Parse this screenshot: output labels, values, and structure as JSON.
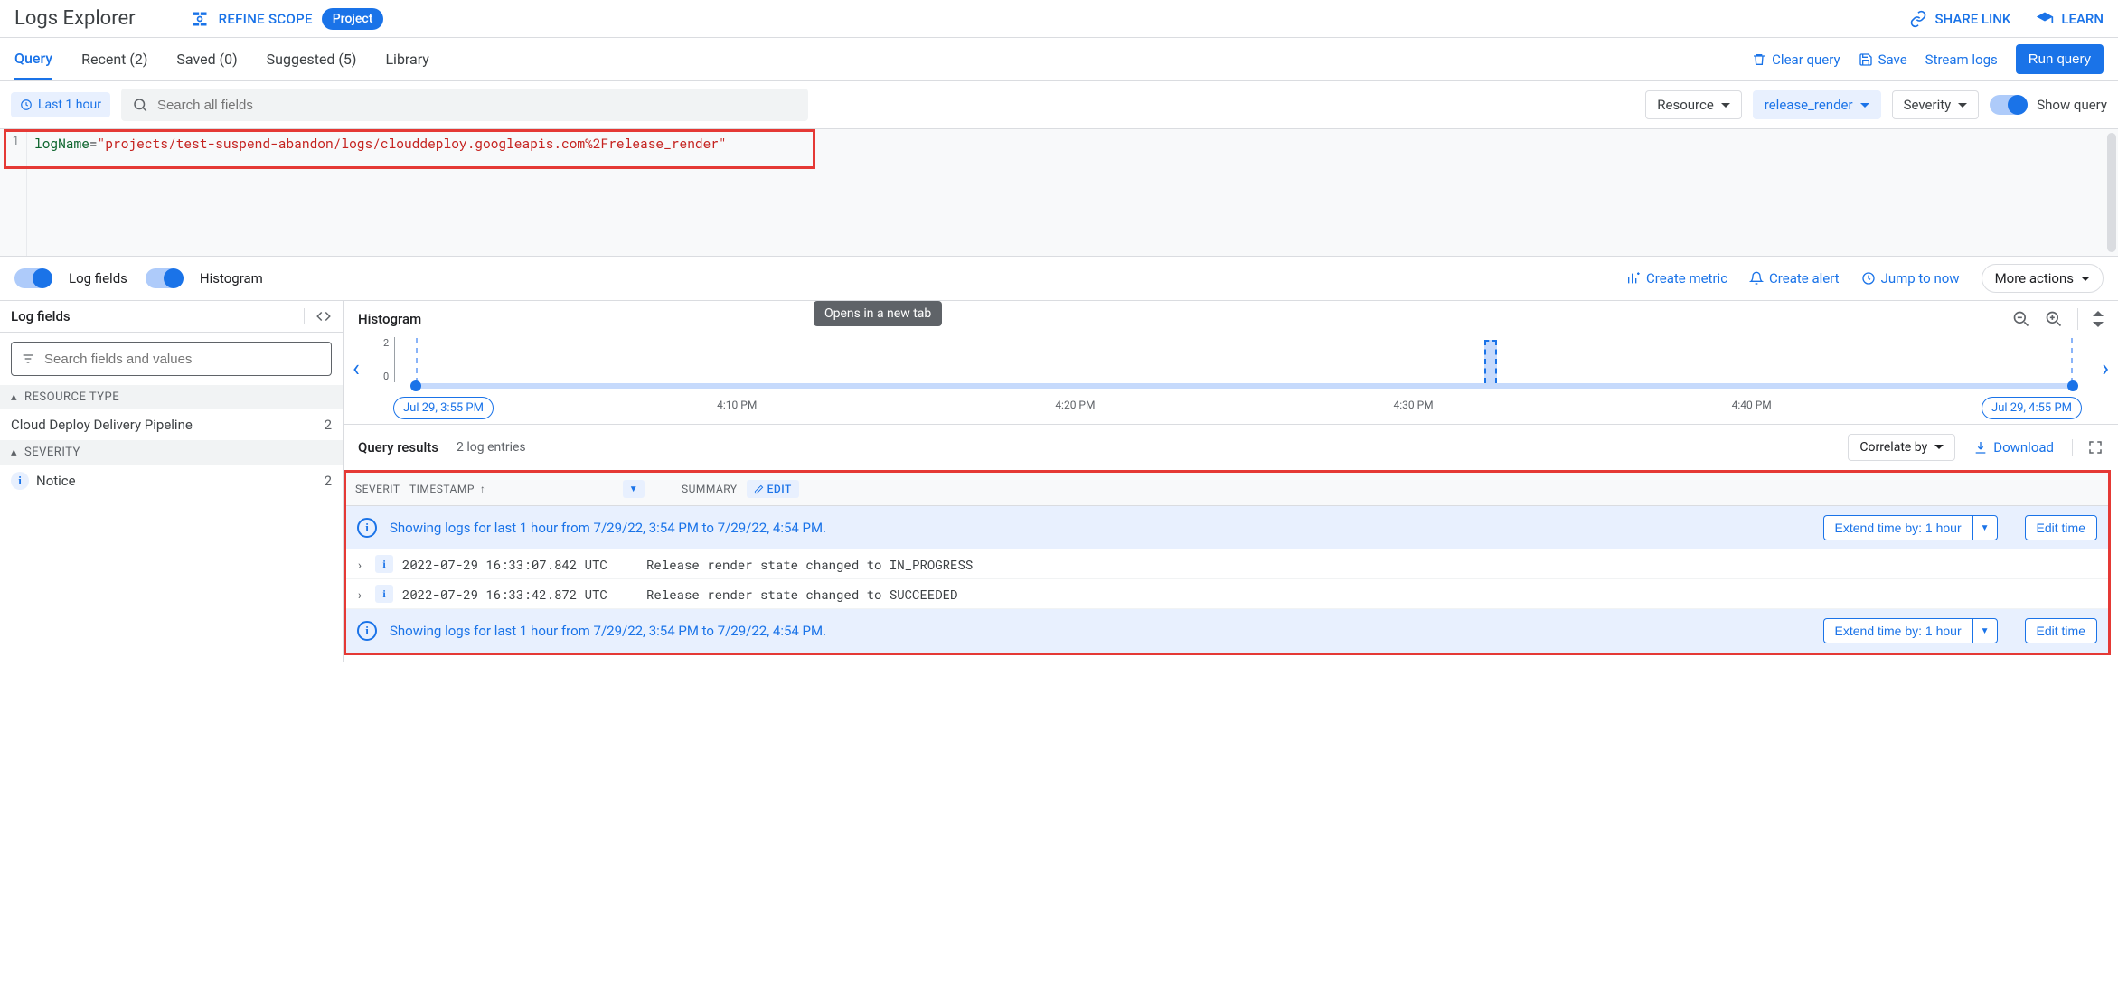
{
  "header": {
    "title": "Logs Explorer",
    "refine_label": "REFINE SCOPE",
    "scope_pill": "Project",
    "share_link": "SHARE LINK",
    "learn": "LEARN"
  },
  "tabs": {
    "items": [
      {
        "label": "Query",
        "active": true
      },
      {
        "label": "Recent (2)"
      },
      {
        "label": "Saved (0)"
      },
      {
        "label": "Suggested (5)"
      },
      {
        "label": "Library"
      }
    ],
    "clear_query": "Clear query",
    "save": "Save",
    "stream_logs": "Stream logs",
    "run_query": "Run query"
  },
  "filters": {
    "time_range": "Last 1 hour",
    "search_placeholder": "Search all fields",
    "resource": "Resource",
    "log_name_chip": "release_render",
    "severity": "Severity",
    "show_query": "Show query"
  },
  "query": {
    "line_no": "1",
    "key": "logName",
    "op": "=",
    "value": "\"projects/test-suspend-abandon/logs/clouddeploy.googleapis.com%2Frelease_render\""
  },
  "midbar": {
    "log_fields": "Log fields",
    "histogram": "Histogram",
    "create_metric": "Create metric",
    "create_alert": "Create alert",
    "jump_to_now": "Jump to now",
    "more_actions": "More actions"
  },
  "tooltip": "Opens in a new tab",
  "left_panel": {
    "title": "Log fields",
    "search_placeholder": "Search fields and values",
    "resource_type_hdr": "RESOURCE TYPE",
    "resource_rows": [
      {
        "label": "Cloud Deploy Delivery Pipeline",
        "count": "2"
      }
    ],
    "severity_hdr": "SEVERITY",
    "severity_rows": [
      {
        "label": "Notice",
        "count": "2"
      }
    ]
  },
  "histogram": {
    "title": "Histogram",
    "y_ticks": [
      "2",
      "0"
    ],
    "x_ticks": [
      "4:10 PM",
      "4:20 PM",
      "4:30 PM",
      "4:40 PM"
    ],
    "start_chip": "Jul 29, 3:55 PM",
    "end_chip": "Jul 29, 4:55 PM"
  },
  "results": {
    "title": "Query results",
    "count_label": "2 log entries",
    "correlate": "Correlate by",
    "download": "Download",
    "columns": {
      "severity": "SEVERITY",
      "timestamp": "TIMESTAMP",
      "summary": "SUMMARY",
      "edit": "EDIT"
    },
    "info_rows": {
      "message": "Showing logs for last 1 hour from 7/29/22, 3:54 PM to 7/29/22, 4:54 PM.",
      "extend_label": "Extend time by: 1 hour",
      "edit_time": "Edit time"
    },
    "logs": [
      {
        "timestamp": "2022-07-29 16:33:07.842 UTC",
        "summary": "Release render state changed to IN_PROGRESS"
      },
      {
        "timestamp": "2022-07-29 16:33:42.872 UTC",
        "summary": "Release render state changed to SUCCEEDED"
      }
    ]
  }
}
